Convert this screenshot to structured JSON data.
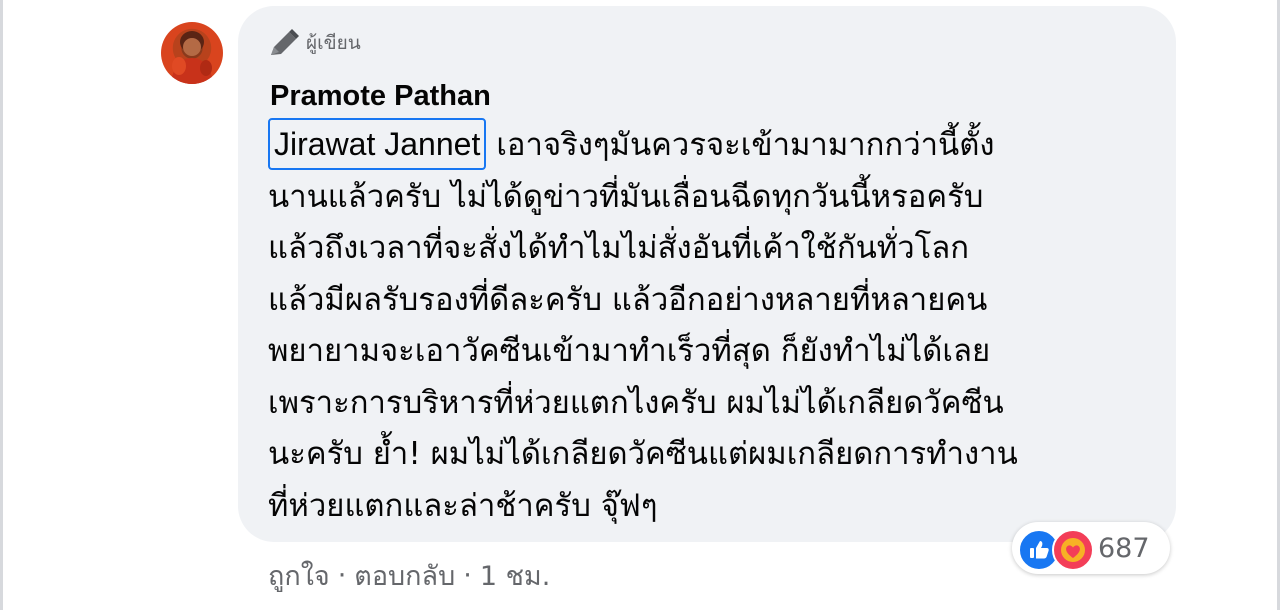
{
  "comment": {
    "author_badge": "ผู้เขียน",
    "author_name": "Pramote Pathan",
    "mention": "Jirawat Jannet",
    "lines": [
      "เอาจริงๆมันควรจะเข้ามามากกว่านี้ตั้ง",
      "นานแล้วครับ ไม่ได้ดูข่าวที่มันเลื่อนฉีดทุกวันนี้หรอครับ",
      "แล้วถึงเวลาที่จะสั่งได้ทำไมไม่สั่งอันที่เค้าใช้กันทั่วโลก",
      "แล้วมีผลรับรองที่ดีละครับ แล้วอีกอย่างหลายที่หลายคน",
      "พยายามจะเอาวัคซีนเข้ามาทำเร็วที่สุด ก็ยังทำไม่ได้เลย",
      "เพราะการบริหารที่ห่วยแตกไงครับ ผมไม่ได้เกลียดวัคซีน",
      "นะครับ ย้ำ! ผมไม่ได้เกลียดวัคซีนแต่ผมเกลียดการทำงาน",
      "ที่ห่วยแตกและล่าช้าครับ จุ๊ฟๆ"
    ]
  },
  "reactions": {
    "icons": [
      "like-icon",
      "care-icon"
    ],
    "count": "687"
  },
  "actions": {
    "like_label": "ถูกใจ",
    "separator": "·",
    "reply_label": "ตอบกลับ",
    "time": "1 ชม."
  },
  "colors": {
    "bubble": "#f0f2f5",
    "mention_border": "#1877f2",
    "like_blue": "#1877f2",
    "care_red": "#f33e58",
    "meta_gray": "#65676b",
    "text": "#050505"
  }
}
